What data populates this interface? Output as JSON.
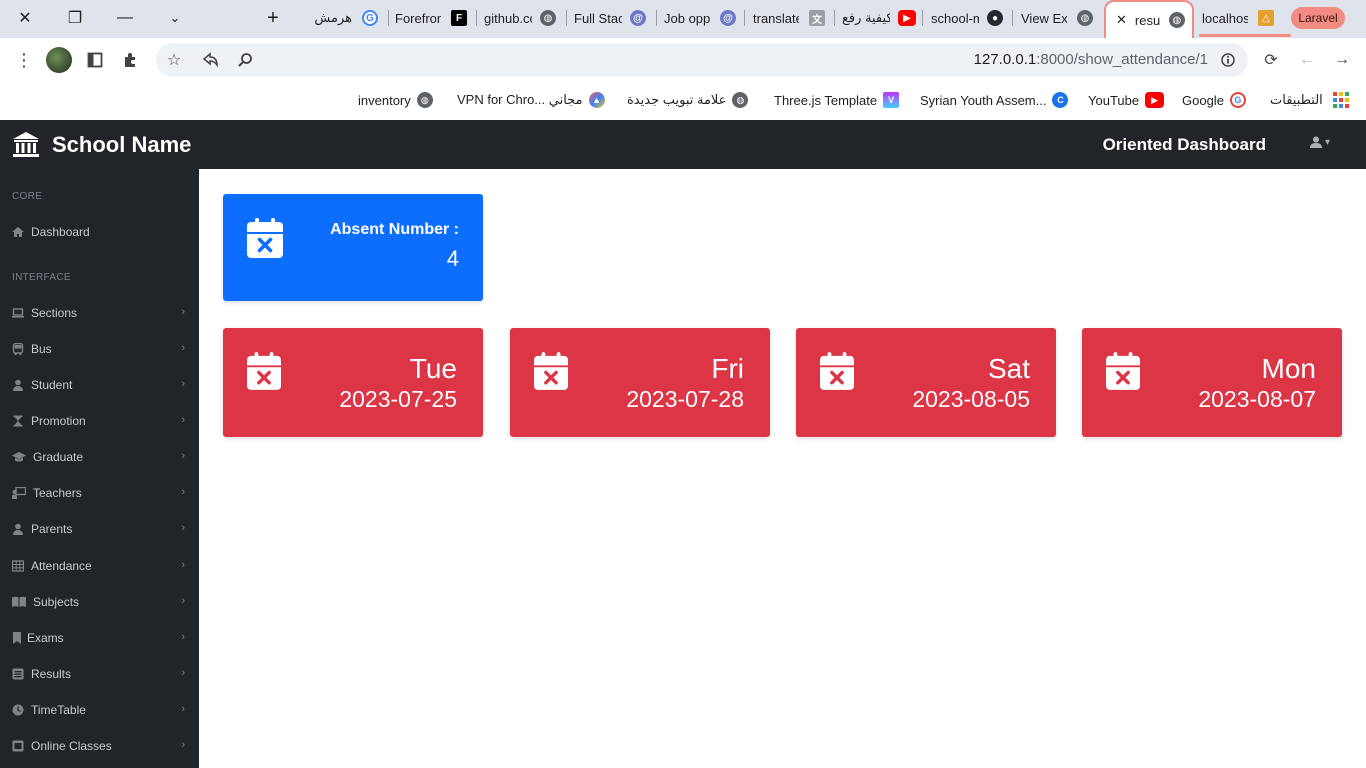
{
  "browser": {
    "tabs": [
      {
        "title": "هرمش",
        "icon": "google-icon"
      },
      {
        "title": "Forefront",
        "icon": "forefront-icon"
      },
      {
        "title": "github.com",
        "icon": "globe-icon"
      },
      {
        "title": "Full Stack",
        "icon": "swirl-icon"
      },
      {
        "title": "Job opp",
        "icon": "swirl-icon"
      },
      {
        "title": "translate",
        "icon": "translate-icon"
      },
      {
        "title": "كيفية رفع",
        "icon": "youtube-icon"
      },
      {
        "title": "school-m",
        "icon": "github-icon"
      },
      {
        "title": "View Ex",
        "icon": "globe-icon"
      },
      {
        "title": "resu",
        "icon": "globe-icon",
        "active": true
      },
      {
        "title": "localhost",
        "icon": "laravel-logo-icon"
      }
    ],
    "tab_group_label": "Laravel",
    "url_host": "127.0.0.1",
    "url_path": ":8000/show_attendance/1",
    "bookmarks": [
      {
        "label": "inventory",
        "icon": "globe-icon"
      },
      {
        "label": "VPN for Chro... مجاني",
        "icon": "vpn-icon"
      },
      {
        "label": "علامة تبويب جديدة",
        "icon": "globe-icon"
      },
      {
        "label": "Three.js Template",
        "icon": "vite-icon"
      },
      {
        "label": "Syrian Youth Assem...",
        "icon": "c-logo-icon"
      },
      {
        "label": "YouTube",
        "icon": "youtube-icon"
      },
      {
        "label": "Google",
        "icon": "google-icon"
      },
      {
        "label": "التطبيقات",
        "icon": "apps-grid-icon"
      }
    ]
  },
  "app": {
    "brand": "School Name",
    "dashboard_title": "Oriented Dashboard",
    "sidebar": {
      "core_heading": "CORE",
      "interface_heading": "INTERFACE",
      "dashboard": "Dashboard",
      "items": [
        "Sections",
        "Bus",
        "Student",
        "Promotion",
        "Graduate",
        "Teachers",
        "Parents",
        "Attendance",
        "Subjects",
        "Exams",
        "Results",
        "TimeTable",
        "Online Classes"
      ]
    },
    "summary": {
      "label": "Absent Number :",
      "count": "4"
    },
    "absences": [
      {
        "day": "Tue",
        "date": "2023-07-25"
      },
      {
        "day": "Fri",
        "date": "2023-07-28"
      },
      {
        "day": "Sat",
        "date": "2023-08-05"
      },
      {
        "day": "Mon",
        "date": "2023-08-07"
      }
    ],
    "colors": {
      "primary": "#0d6efd",
      "danger": "#dc3545",
      "dark": "#212529"
    }
  }
}
